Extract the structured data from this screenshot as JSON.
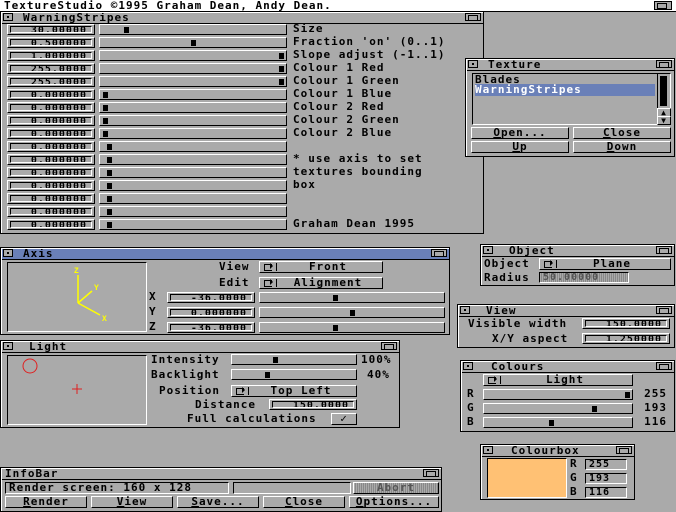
{
  "screen_title": "TextureStudio ©1995 Graham Dean, Andy Dean.",
  "warning": {
    "title": "WarningStripes",
    "params": [
      {
        "value": "30.00000",
        "slider": 0.12,
        "label": "Size"
      },
      {
        "value": "0.500000",
        "slider": 0.5,
        "label": "Fraction 'on' (0..1)"
      },
      {
        "value": "1.000000",
        "slider": 1.0,
        "label": "Slope adjust (-1..1)"
      },
      {
        "value": "255.0000",
        "slider": 1.0,
        "label": "Colour 1 Red"
      },
      {
        "value": "255.0000",
        "slider": 1.0,
        "label": "Colour 1 Green"
      },
      {
        "value": "0.000000",
        "slider": 0.0,
        "label": "Colour 1 Blue"
      },
      {
        "value": "0.000000",
        "slider": 0.0,
        "label": "Colour 2 Red"
      },
      {
        "value": "0.000000",
        "slider": 0.0,
        "label": "Colour 2 Green"
      },
      {
        "value": "0.000000",
        "slider": 0.0,
        "label": "Colour 2 Blue"
      },
      {
        "value": "0.000000",
        "slider": 0.02,
        "label": ""
      },
      {
        "value": "0.000000",
        "slider": 0.02,
        "label": "* use axis to set"
      },
      {
        "value": "0.000000",
        "slider": 0.02,
        "label": "textures bounding"
      },
      {
        "value": "0.000000",
        "slider": 0.02,
        "label": "box"
      },
      {
        "value": "0.000000",
        "slider": 0.02,
        "label": ""
      },
      {
        "value": "0.000000",
        "slider": 0.02,
        "label": ""
      },
      {
        "value": "0.000000",
        "slider": 0.02,
        "label": "Graham Dean 1995"
      }
    ]
  },
  "texture": {
    "title": "Texture",
    "items": [
      "Blades",
      "WarningStripes"
    ],
    "selected_index": 1,
    "buttons": {
      "open": "Open...",
      "close": "Close",
      "up": "Up",
      "down": "Down"
    }
  },
  "axis": {
    "title": "Axis",
    "view_label": "View",
    "view_value": "Front",
    "edit_label": "Edit",
    "edit_value": "Alignment",
    "axis_z": "Z",
    "axis_y": "Y",
    "axis_x": "X",
    "rows": [
      {
        "label": "X",
        "value": "-36.0000",
        "slider": 0.4
      },
      {
        "label": "Y",
        "value": "0.000000",
        "slider": 0.5
      },
      {
        "label": "Z",
        "value": "-36.0000",
        "slider": 0.4
      }
    ]
  },
  "object": {
    "title": "Object",
    "object_label": "Object",
    "object_value": "Plane",
    "radius_label": "Radius",
    "radius_value": "50.00000"
  },
  "view": {
    "title": "View",
    "visible_width_label": "Visible width",
    "visible_width_value": "150.0000",
    "aspect_label": "X/Y aspect",
    "aspect_value": "1.250000"
  },
  "light": {
    "title": "Light",
    "intensity_label": "Intensity",
    "intensity_value": "100%",
    "intensity_slider": 0.33,
    "backlight_label": "Backlight",
    "backlight_value": "40%",
    "backlight_slider": 0.26,
    "position_label": "Position",
    "position_value": "Top Left",
    "distance_label": "Distance",
    "distance_value": "150.0000",
    "full_calc_label": "Full calculations",
    "full_calc_checked": true
  },
  "colours": {
    "title": "Colours",
    "mode": "Light",
    "rows": [
      {
        "label": "R",
        "value": "255",
        "slider": 1.0
      },
      {
        "label": "G",
        "value": "193",
        "slider": 0.76
      },
      {
        "label": "B",
        "value": "116",
        "slider": 0.45
      }
    ]
  },
  "colourbox": {
    "title": "Colourbox",
    "swatch": "#ffc174",
    "r_label": "R",
    "r_value": "255",
    "g_label": "G",
    "g_value": "193",
    "b_label": "B",
    "b_value": "116"
  },
  "infobar": {
    "title": "InfoBar",
    "message": "Render screen: 160 x 128",
    "abort": "Abort",
    "buttons": {
      "render": "Render",
      "view": "View",
      "save": "Save...",
      "close": "Close",
      "options": "Options..."
    }
  },
  "colors": {
    "titlebar_active": "#6a80b8",
    "background": "#aaaaaa",
    "selection": "#6a80b8",
    "axis_yellow": "#ffff00",
    "light_red": "#e02020"
  }
}
